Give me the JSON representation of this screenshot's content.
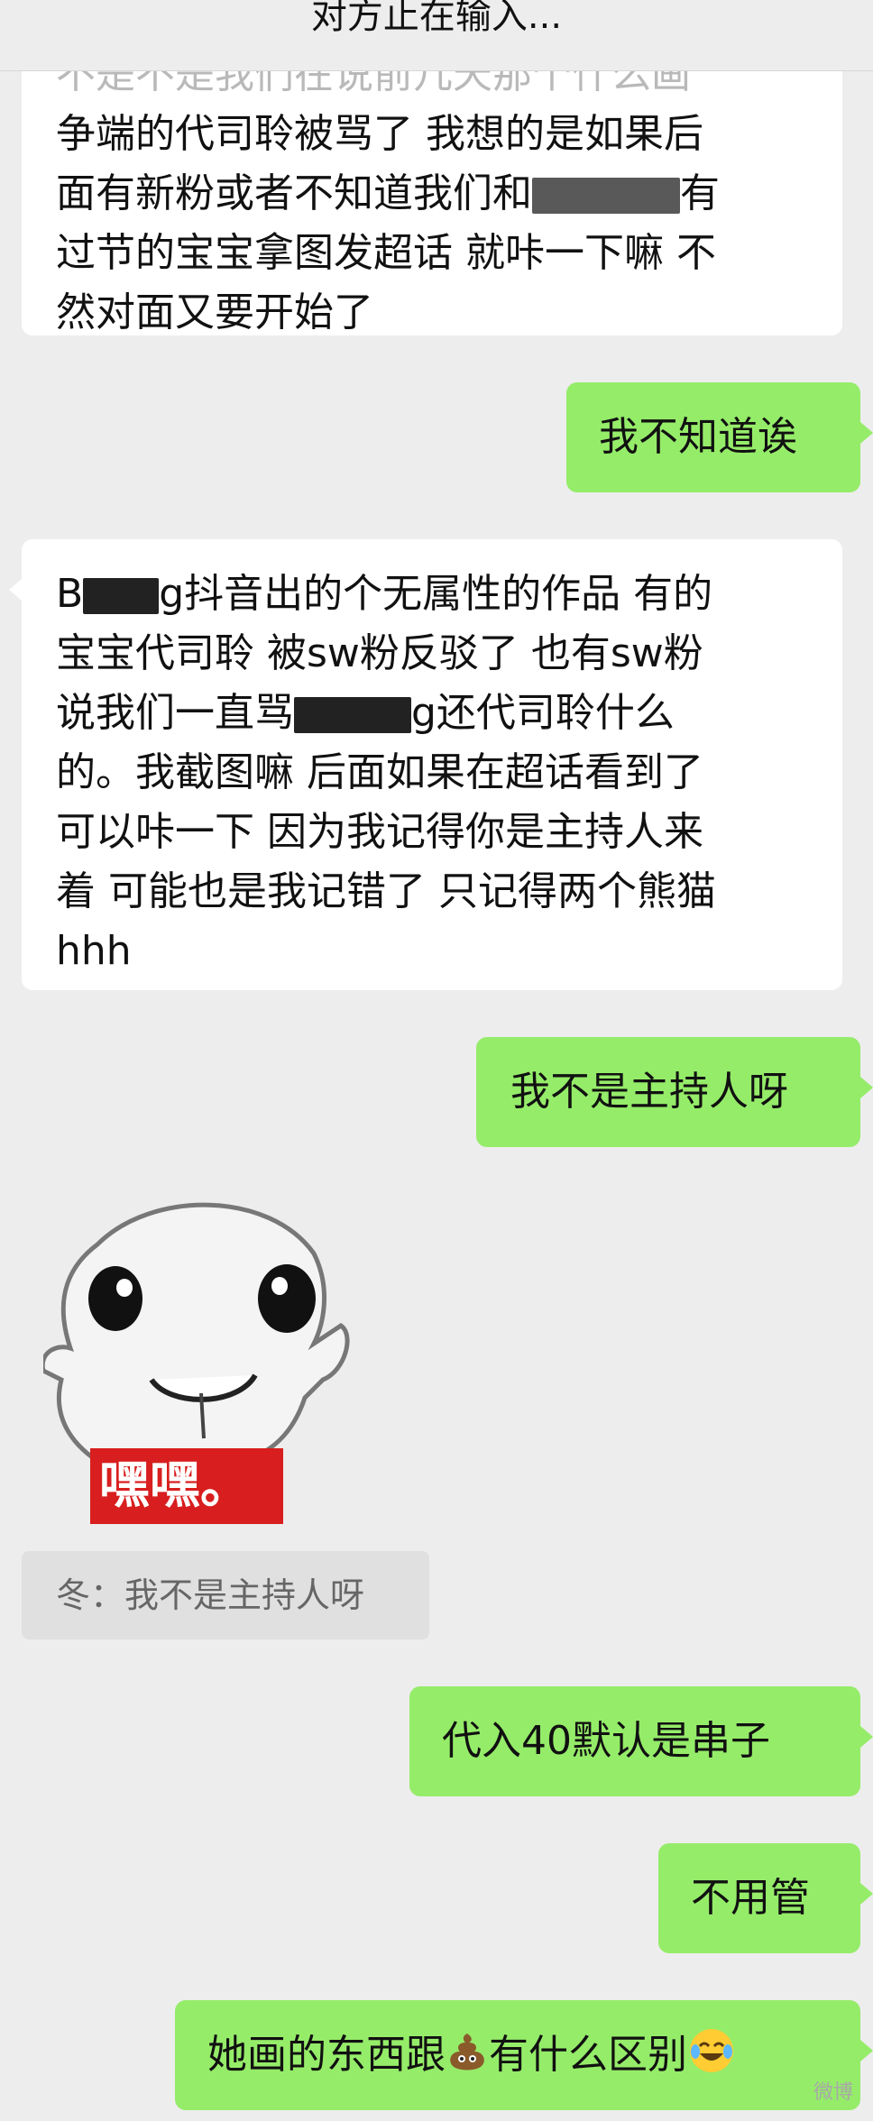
{
  "header": {
    "title": "对方止在输入..."
  },
  "messages": {
    "m1": {
      "cut_line": "不是不是我们在说前几天那个什么画",
      "line1": "争端的代司聆被骂了 我想的是如果后",
      "line2a": "面有新粉或者不知道我们和",
      "line2b": "有",
      "line3": "过节的宝宝拿图发超话 就咔一下嘛 不",
      "line4": "然对面又要开始了"
    },
    "m2": {
      "text": "我不知道诶"
    },
    "m3": {
      "line1a": "B",
      "line1b": "g抖音出的个无属性的作品 有的",
      "line2": "宝宝代司聆 被sw粉反驳了 也有sw粉",
      "line3a": "说我们一直骂",
      "line3b": "g还代司聆什么",
      "line4": "的。我截图嘛 后面如果在超话看到了",
      "line5": "可以咔一下 因为我记得你是主持人来",
      "line6": "着 可能也是我记错了 只记得两个熊猫",
      "line7": "hhh"
    },
    "m4": {
      "text": "我不是主持人呀"
    },
    "sticker": {
      "caption": "嘿嘿。",
      "icon": "grinning-white-face-sticker"
    },
    "quote": {
      "text": "冬：我不是主持人呀"
    },
    "m5": {
      "text": "代入40默认是串子"
    },
    "m6": {
      "text": "不用管"
    },
    "m7": {
      "text_a": "她画的东西跟",
      "text_b": "有什么区别",
      "emoji1": "poop-emoji",
      "emoji2": "tears-of-joy-emoji"
    }
  },
  "watermark": {
    "text": "微博"
  },
  "colors": {
    "background": "#ededed",
    "sent_bubble": "#95ec69",
    "received_bubble": "#ffffff",
    "sticker_red": "#d81e1e"
  }
}
